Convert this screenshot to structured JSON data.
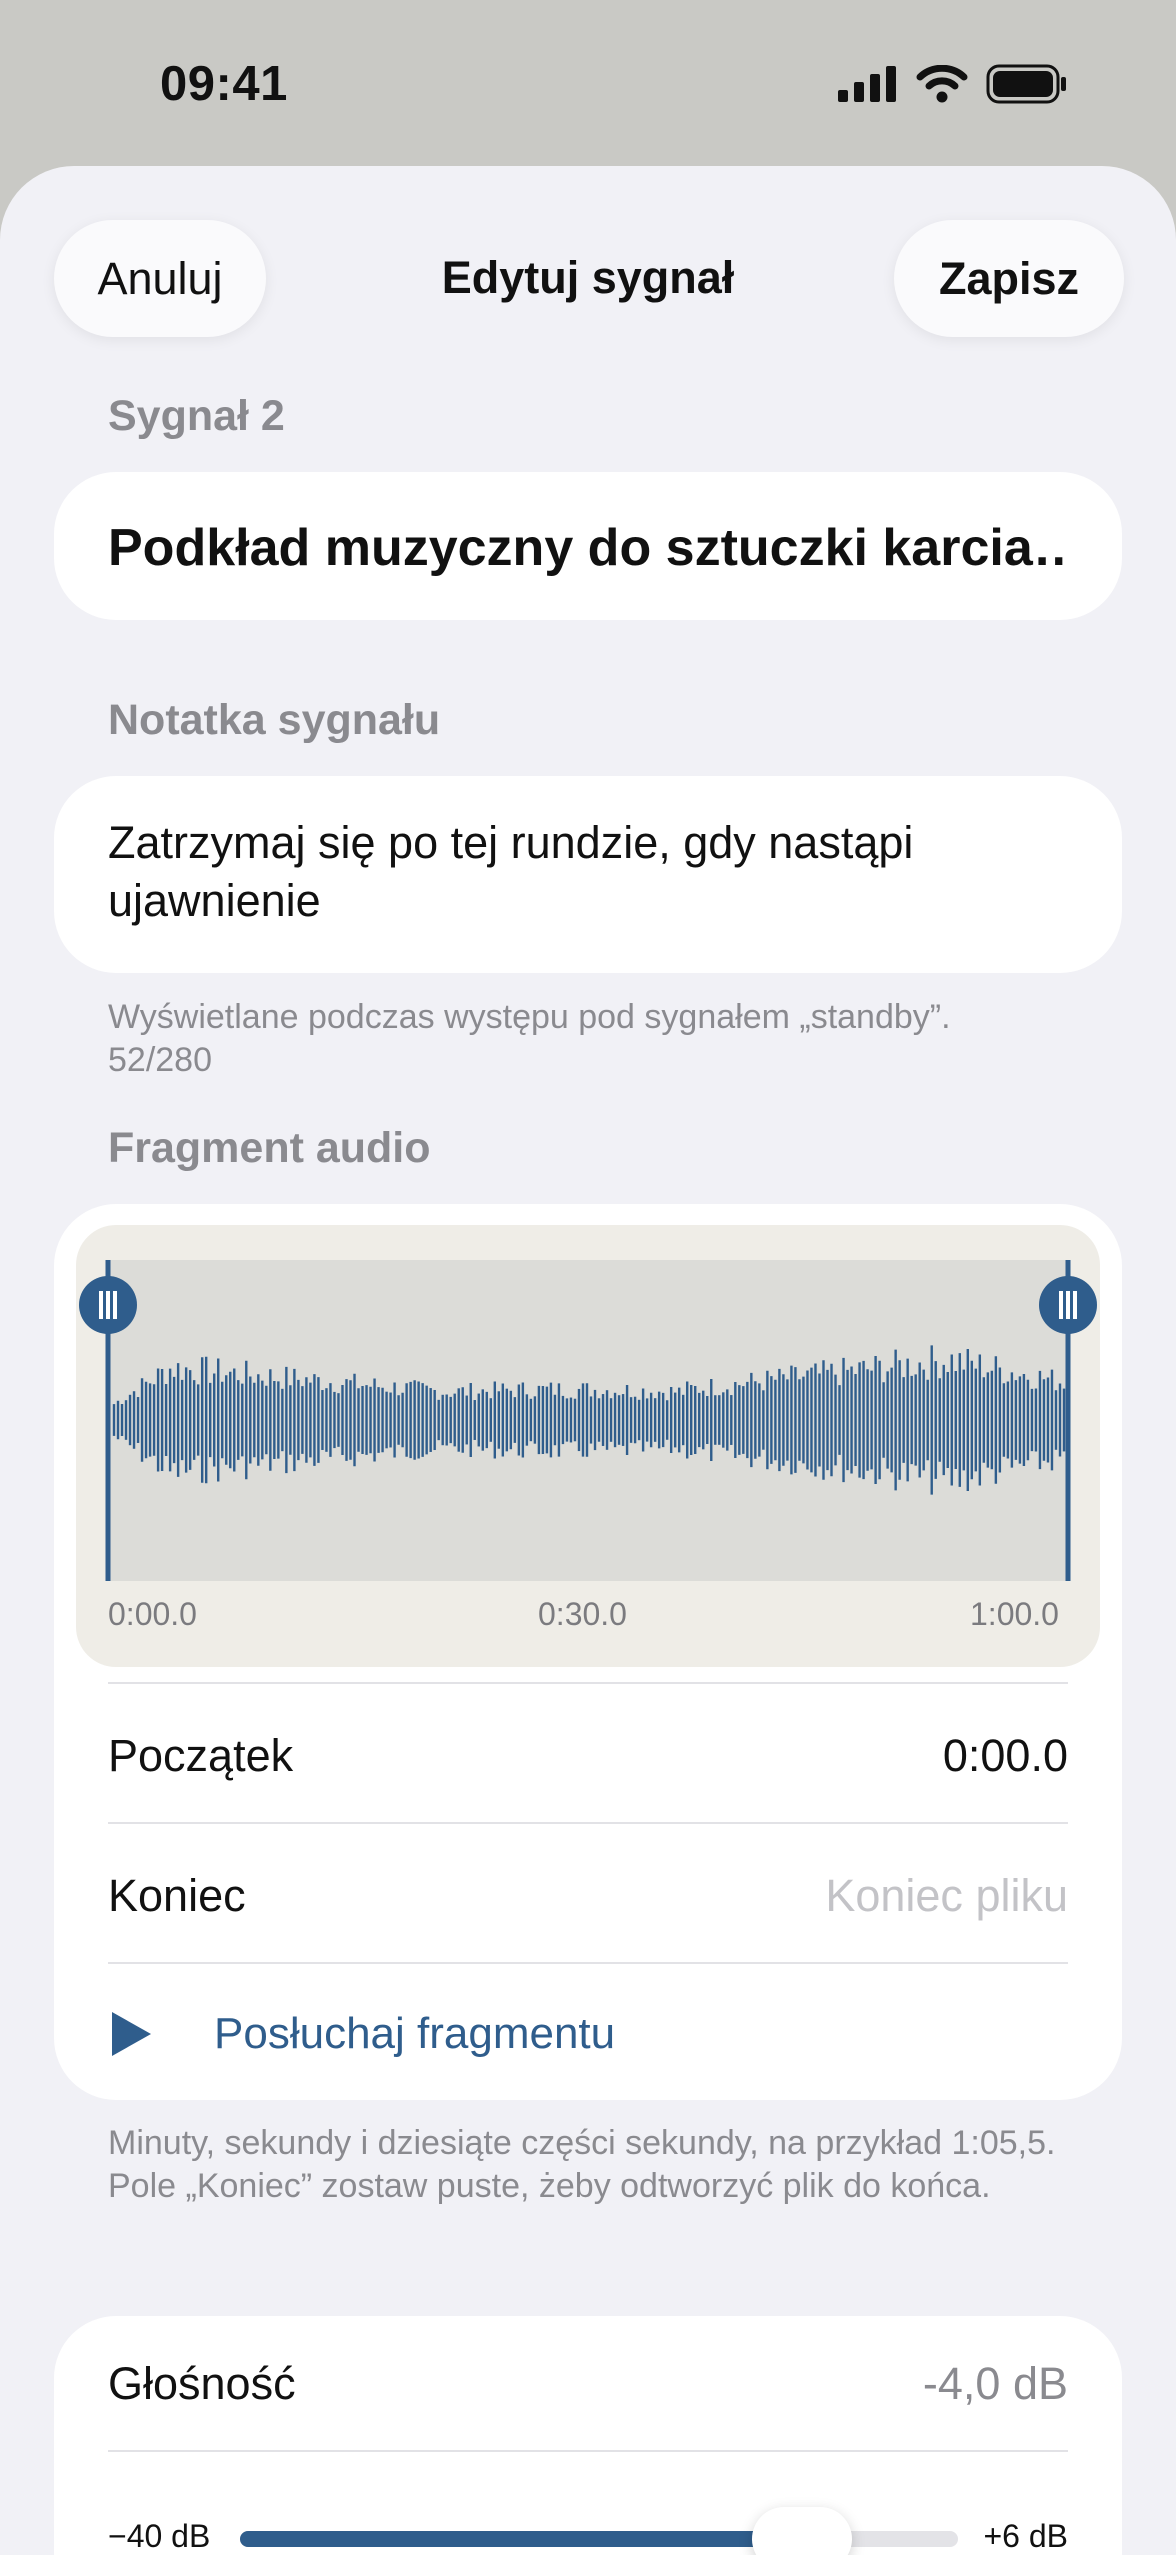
{
  "status": {
    "time": "09:41"
  },
  "nav": {
    "cancel_label": "Anuluj",
    "title": "Edytuj sygnał",
    "save_label": "Zapisz"
  },
  "cue": {
    "section_label": "Sygnał 2",
    "name": "Podkład muzyczny do sztuczki karcia…",
    "note_label": "Notatka sygnału",
    "note_line1": "Zatrzymaj się po tej rundzie, gdy nastąpi",
    "note_line2": "ujawnienie",
    "note_helper": "Wyświetlane podczas występu pod sygnałem „standby”.",
    "note_counter": "52/280"
  },
  "audio": {
    "section_label": "Fragment audio",
    "time_start": "0:00.0",
    "time_mid": "0:30.0",
    "time_end": "1:00.0",
    "start_label": "Początek",
    "start_value": "0:00.0",
    "end_label": "Koniec",
    "end_placeholder": "Koniec pliku",
    "play_label": "Posłuchaj fragmentu",
    "helper": "Minuty, sekundy i dziesiąte części sekundy, na przykład 1:05,5. Pole „Koniec” zostaw puste, żeby odtworzyć plik do końca.",
    "accent_color": "#2f5d8c"
  },
  "volume": {
    "label": "Głośność",
    "value": "-4,0 dB",
    "min_label": "−40 dB",
    "max_label": "+6 dB",
    "level_fraction": 0.783
  }
}
